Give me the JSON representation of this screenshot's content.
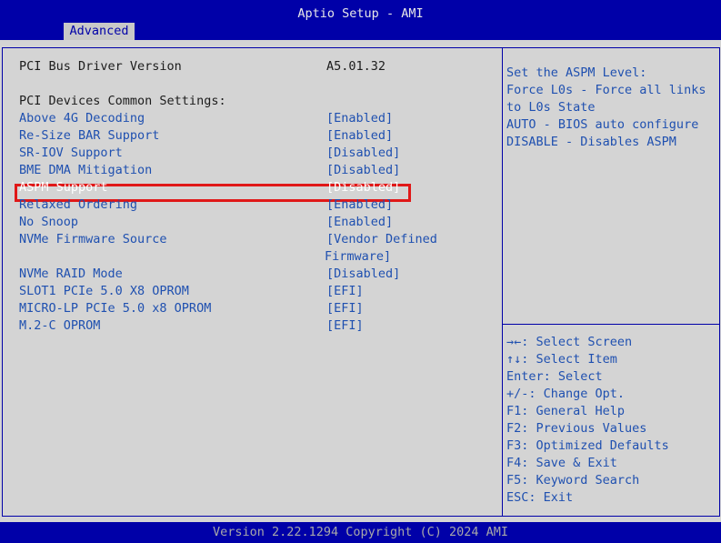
{
  "app_title": "Aptio Setup - AMI",
  "tabs": [
    {
      "label": "Advanced"
    }
  ],
  "driver": {
    "label": "PCI Bus Driver Version",
    "value": "A5.01.32"
  },
  "section_heading": "PCI Devices Common Settings:",
  "settings": [
    {
      "label": "Above 4G Decoding",
      "value": "[Enabled]"
    },
    {
      "label": "Re-Size BAR Support",
      "value": "[Enabled]"
    },
    {
      "label": "SR-IOV Support",
      "value": "[Disabled]"
    },
    {
      "label": "BME DMA Mitigation",
      "value": "[Disabled]"
    },
    {
      "label": "ASPM Support",
      "value": "[Disabled]"
    },
    {
      "label": "Relaxed Ordering",
      "value": "[Enabled]"
    },
    {
      "label": "No Snoop",
      "value": "[Enabled]"
    },
    {
      "label": "NVMe Firmware Source",
      "value": "[Vendor Defined",
      "value_line2": "Firmware]"
    },
    {
      "label": "NVMe RAID Mode",
      "value": "[Disabled]"
    },
    {
      "label": "SLOT1 PCIe 5.0 X8 OPROM",
      "value": "[EFI]"
    },
    {
      "label": "MICRO-LP PCIe 5.0 x8 OPROM",
      "value": "[EFI]"
    },
    {
      "label": "M.2-C OPROM",
      "value": "[EFI]"
    }
  ],
  "help_text": [
    "Set the ASPM Level:",
    "Force L0s - Force all links",
    "to L0s State",
    "AUTO - BIOS auto configure",
    "DISABLE - Disables ASPM"
  ],
  "key_help": [
    "→←: Select Screen",
    "↑↓: Select Item",
    "Enter: Select",
    "+/-: Change Opt.",
    "F1: General Help",
    "F2: Previous Values",
    "F3: Optimized Defaults",
    "F4: Save & Exit",
    "F5: Keyword Search",
    "ESC: Exit"
  ],
  "footer": "Version 2.22.1294 Copyright (C) 2024 AMI",
  "colors": {
    "header_bg": "#0000a8",
    "panel_bg": "#d4d4d4",
    "setting_text": "#1f50b0",
    "highlight": "#e01818"
  }
}
